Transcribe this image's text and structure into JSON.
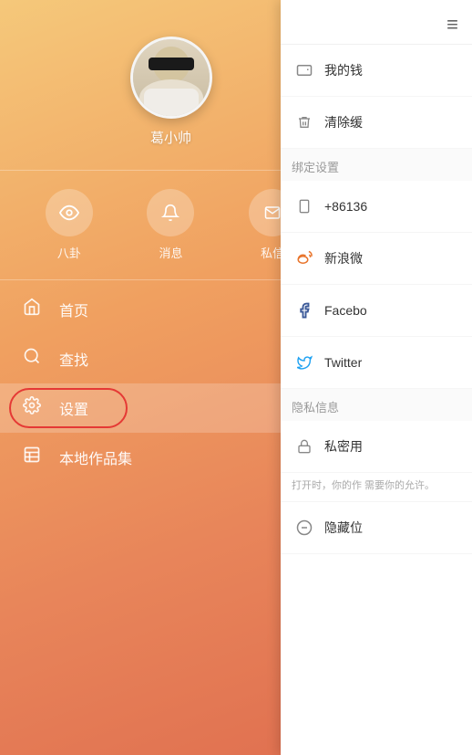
{
  "leftPanel": {
    "username": "葛小帅",
    "actions": [
      {
        "id": "gossip",
        "icon": "👁",
        "label": "八卦"
      },
      {
        "id": "message",
        "icon": "🔔",
        "label": "消息"
      },
      {
        "id": "dm",
        "icon": "✉",
        "label": "私信"
      }
    ],
    "navItems": [
      {
        "id": "home",
        "label": "首页",
        "active": false
      },
      {
        "id": "search",
        "label": "查找",
        "active": false
      },
      {
        "id": "settings",
        "label": "设置",
        "active": true
      },
      {
        "id": "local",
        "label": "本地作品集",
        "active": false
      }
    ]
  },
  "rightPanel": {
    "menuItems": [
      {
        "id": "wallet",
        "label": "我的钱",
        "icon": "wallet"
      },
      {
        "id": "cache",
        "label": "清除缓",
        "icon": "trash"
      }
    ],
    "bindSection": {
      "title": "绑定设置",
      "items": [
        {
          "id": "phone",
          "label": "+86136",
          "icon": "phone"
        },
        {
          "id": "weibo",
          "label": "新浪微",
          "icon": "weibo"
        },
        {
          "id": "facebook",
          "label": "Facebo",
          "icon": "facebook"
        },
        {
          "id": "twitter",
          "label": "Twitter",
          "icon": "twitter"
        }
      ]
    },
    "privacySection": {
      "title": "隐私信息",
      "items": [
        {
          "id": "private-user",
          "label": "私密用",
          "icon": "lock"
        }
      ],
      "description": "打开时，你的作\n需要你的允许。",
      "hiddenItem": {
        "id": "hidden",
        "label": "隐藏位",
        "icon": "minus-circle"
      }
    }
  }
}
